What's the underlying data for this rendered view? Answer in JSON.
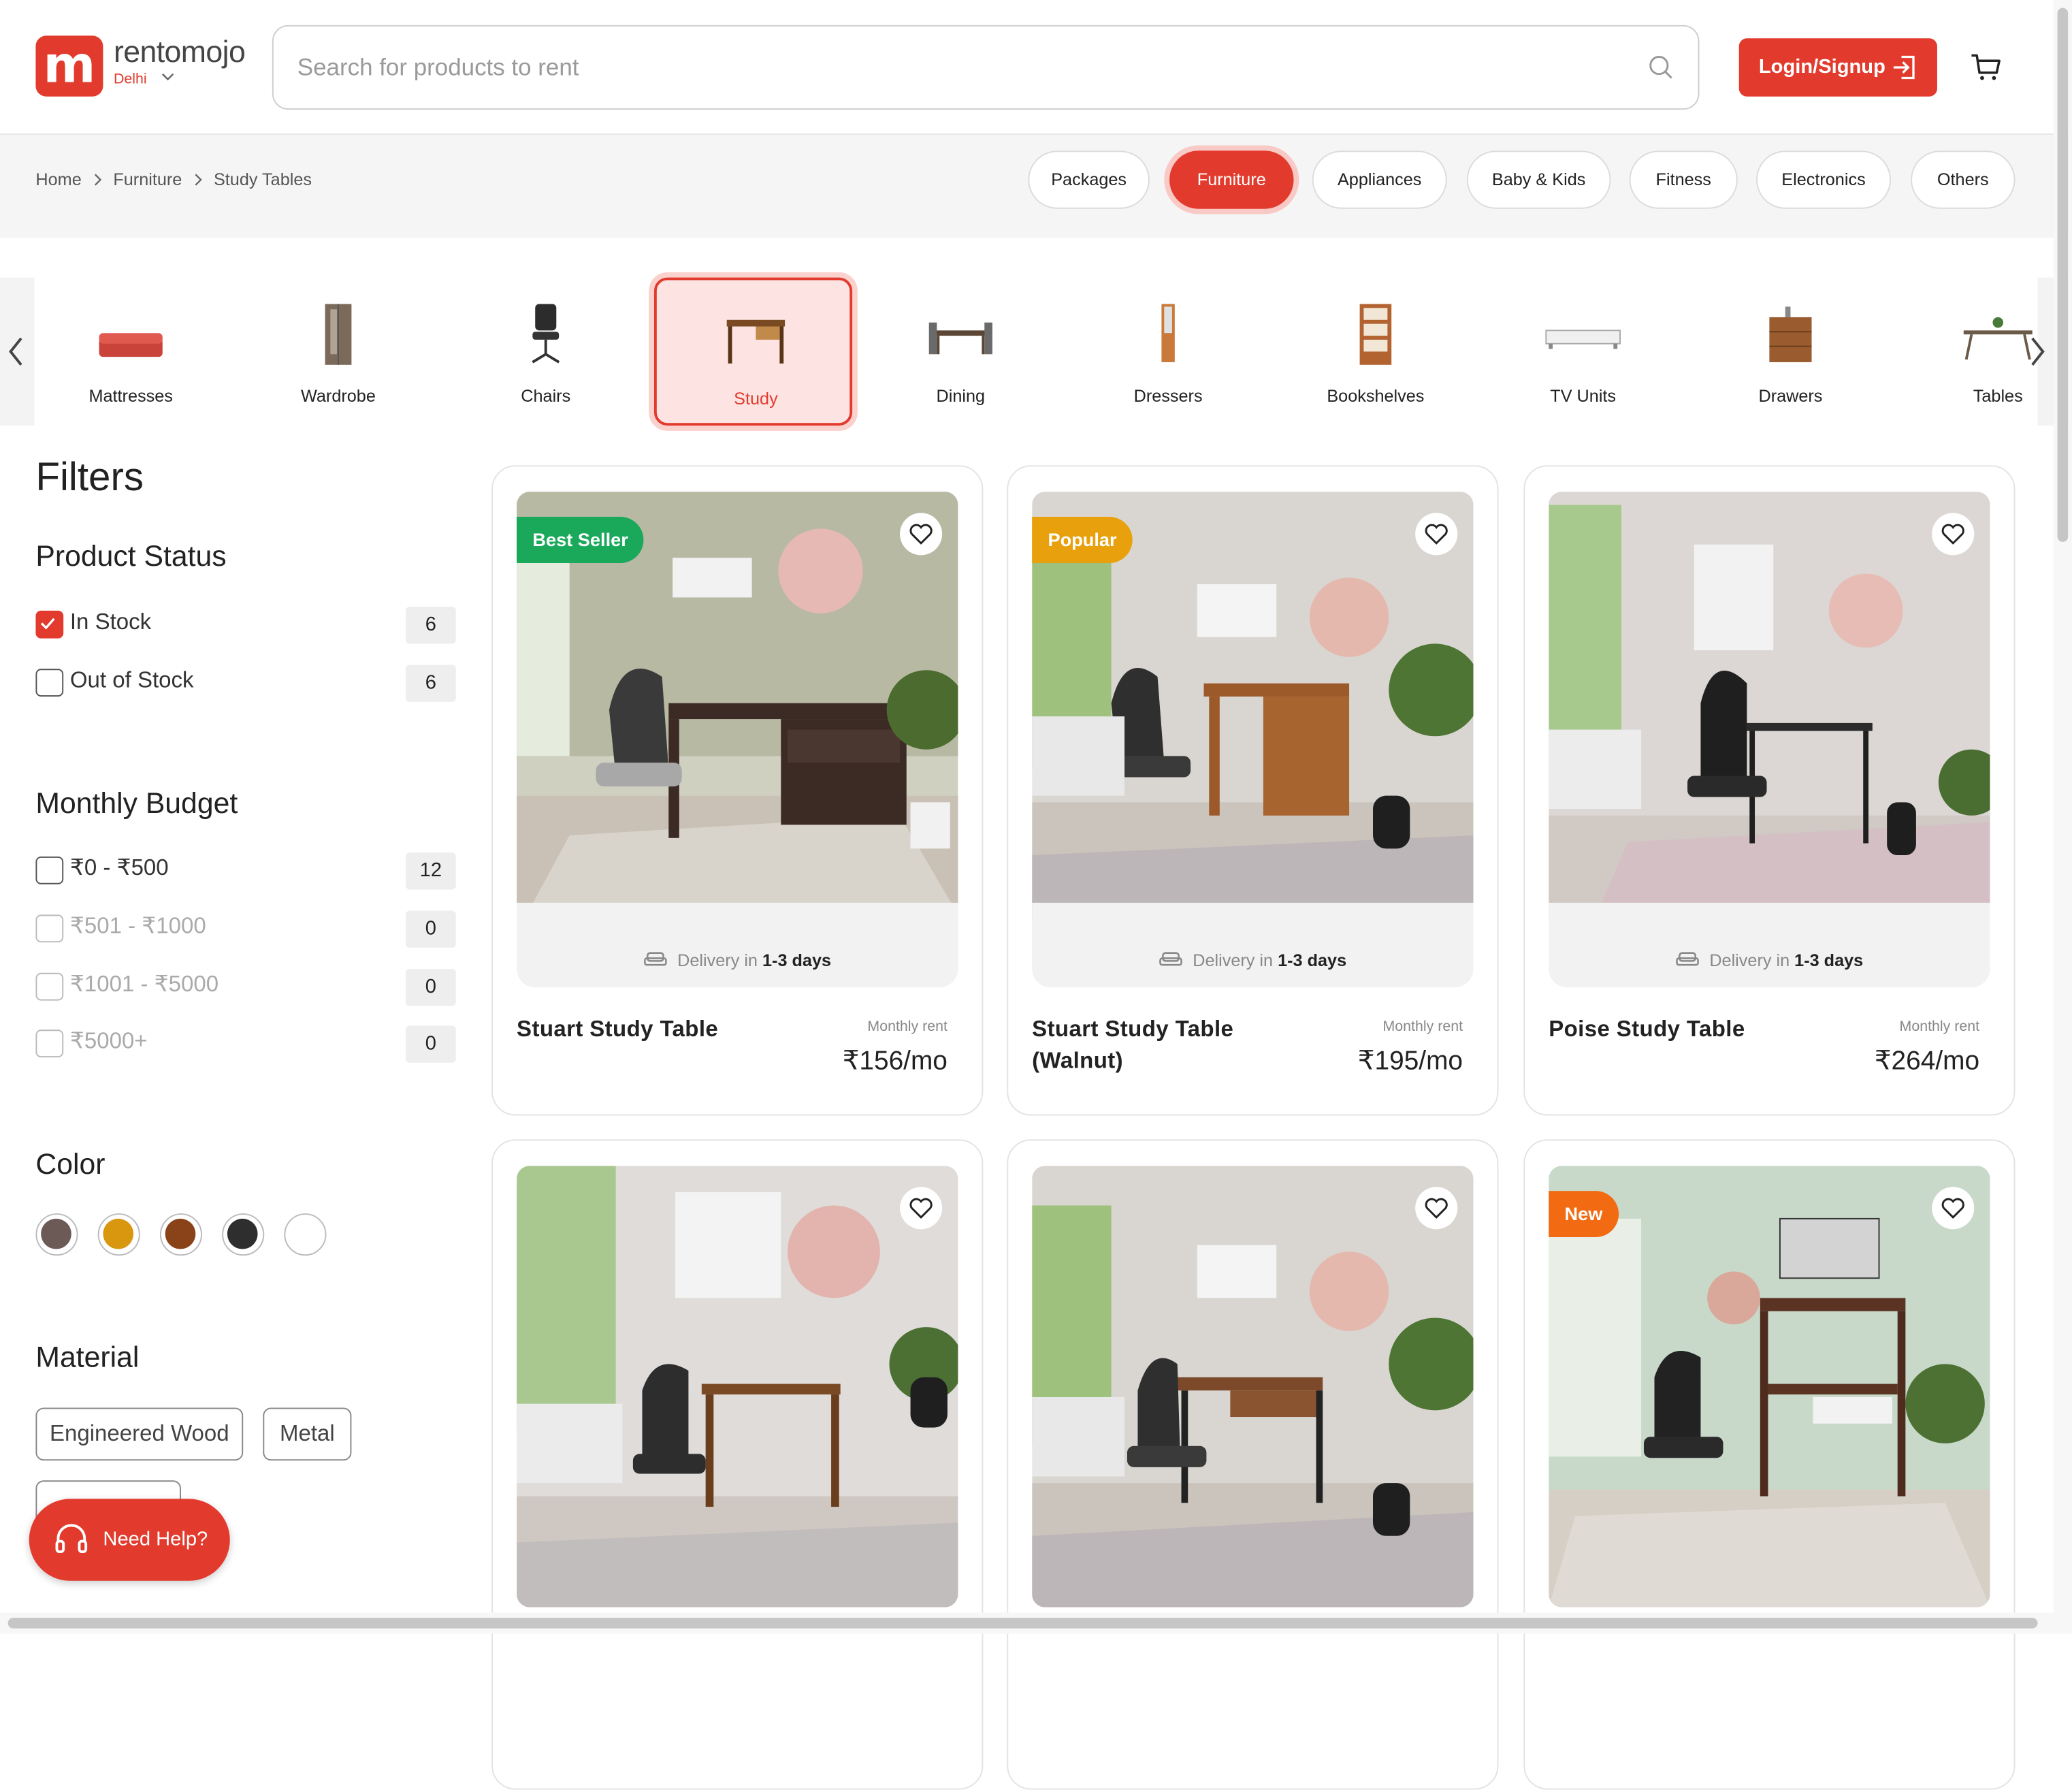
{
  "header": {
    "brand": "rentomojo",
    "city": "Delhi",
    "search_placeholder": "Search for products to rent",
    "login_label": "Login/Signup"
  },
  "breadcrumb": [
    "Home",
    "Furniture",
    "Study Tables"
  ],
  "top_categories": [
    "Packages",
    "Furniture",
    "Appliances",
    "Baby & Kids",
    "Fitness",
    "Electronics",
    "Others"
  ],
  "active_top_category": "Furniture",
  "subcategories": [
    "Mattresses",
    "Wardrobe",
    "Chairs",
    "Study",
    "Dining",
    "Dressers",
    "Bookshelves",
    "TV Units",
    "Drawers",
    "Tables"
  ],
  "active_subcategory": "Study",
  "filters": {
    "title": "Filters",
    "product_status": {
      "title": "Product Status",
      "options": [
        {
          "label": "In Stock",
          "count": "6",
          "checked": true
        },
        {
          "label": "Out of Stock",
          "count": "6",
          "checked": false
        }
      ]
    },
    "monthly_budget": {
      "title": "Monthly Budget",
      "options": [
        {
          "label": "₹0 - ₹500",
          "count": "12"
        },
        {
          "label": "₹501 - ₹1000",
          "count": "0"
        },
        {
          "label": "₹1001 - ₹5000",
          "count": "0"
        },
        {
          "label": "₹5000+",
          "count": "0"
        }
      ]
    },
    "color": {
      "title": "Color",
      "swatches": [
        "#6b5a55",
        "#d9960f",
        "#8a4318",
        "#2e2e2e",
        "#ffffff"
      ]
    },
    "material": {
      "title": "Material",
      "options": [
        "Engineered Wood",
        "Metal"
      ]
    }
  },
  "help_label": "Need Help?",
  "products": [
    {
      "name": "Stuart Study Table",
      "badge": "Best Seller",
      "badge_color": "#1aa85a",
      "monthly_rent_label": "Monthly rent",
      "price": "₹156/mo",
      "delivery_prefix": "Delivery in",
      "delivery_days": "1-3 days"
    },
    {
      "name": "Stuart Study Table (Walnut)",
      "badge": "Popular",
      "badge_color": "#e8a10c",
      "monthly_rent_label": "Monthly rent",
      "price": "₹195/mo",
      "delivery_prefix": "Delivery in",
      "delivery_days": "1-3 days"
    },
    {
      "name": "Poise Study Table",
      "badge": "",
      "badge_color": "",
      "monthly_rent_label": "Monthly rent",
      "price": "₹264/mo",
      "delivery_prefix": "Delivery in",
      "delivery_days": "1-3 days"
    },
    {
      "name": "",
      "badge": "",
      "badge_color": ""
    },
    {
      "name": "",
      "badge": "",
      "badge_color": ""
    },
    {
      "name": "",
      "badge": "New",
      "badge_color": "#f26b12"
    }
  ],
  "colors": {
    "accent": "#e23b2e",
    "accent_light": "#fde4e2"
  }
}
